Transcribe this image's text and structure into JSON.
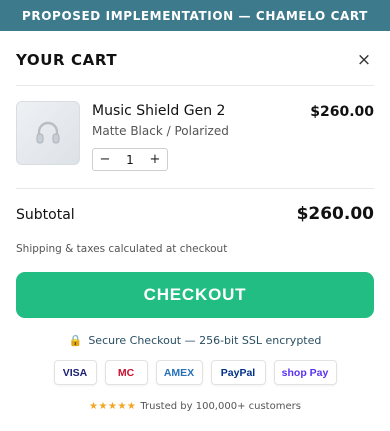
{
  "banner": {
    "text": "PROPOSED IMPLEMENTATION — CHAMELO CART"
  },
  "cart": {
    "title": "YOUR CART",
    "close_icon": "×"
  },
  "item": {
    "name": "Music Shield Gen 2",
    "variant": "Matte Black / Polarized",
    "price": "$260.00",
    "quantity": "1",
    "decrement_label": "−",
    "increment_label": "+",
    "thumbnail_icon": "headphones-icon"
  },
  "summary": {
    "subtotal_label": "Subtotal",
    "subtotal_value": "$260.00",
    "shipping_note": "Shipping & taxes calculated at checkout"
  },
  "checkout": {
    "label": "CHECKOUT"
  },
  "secure": {
    "icon": "🔒",
    "text": "Secure Checkout — 256-bit SSL encrypted"
  },
  "payments": [
    "VISA",
    "MC",
    "AMEX",
    "PayPal",
    "shop Pay"
  ],
  "trust": {
    "stars": "★★★★★",
    "text": "Trusted by 100,000+ customers"
  },
  "colors": {
    "banner": "#3d7a8c",
    "checkout": "#21bd83",
    "secure_text": "#2a4f63",
    "stars": "#f4a623"
  }
}
